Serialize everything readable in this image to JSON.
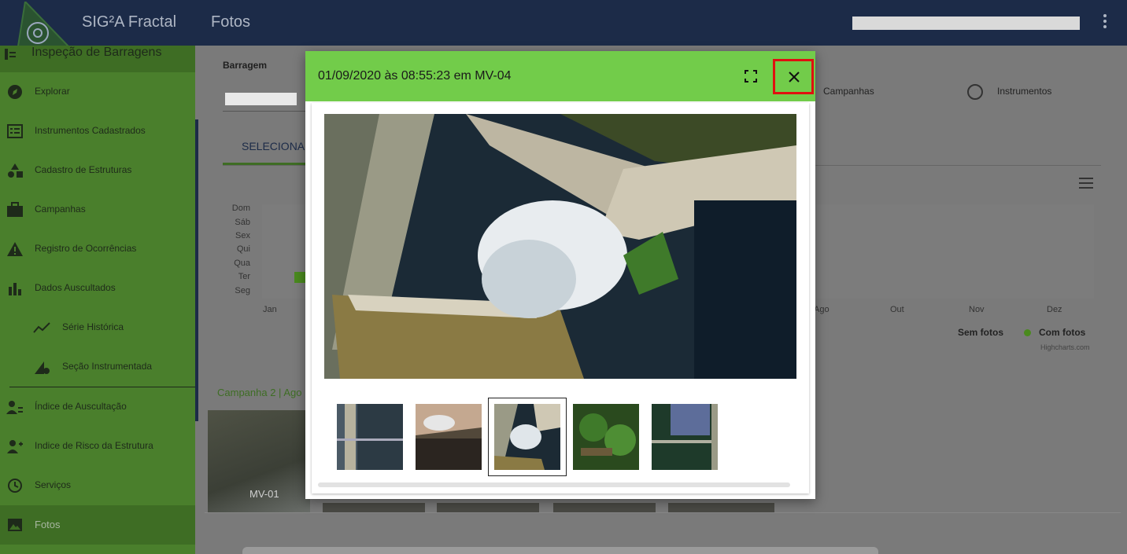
{
  "topbar": {
    "app_title": "SIG²A Fractal",
    "page_title": "Fotos"
  },
  "sidebar": {
    "header": "Inspeção de Barragens",
    "items": [
      {
        "label": "Explorar",
        "icon": "compass-icon"
      },
      {
        "label": "Instrumentos Cadastrados",
        "icon": "list-card-icon"
      },
      {
        "label": "Cadastro de Estruturas",
        "icon": "shapes-icon"
      },
      {
        "label": "Campanhas",
        "icon": "briefcase-icon"
      },
      {
        "label": "Registro de Ocorrências",
        "icon": "warning-icon"
      },
      {
        "label": "Dados Auscultados",
        "icon": "bar-chart-icon"
      },
      {
        "label": "Série Histórica",
        "icon": "trend-line-icon"
      },
      {
        "label": "Seção Instrumentada",
        "icon": "section-gear-icon"
      },
      {
        "label": "Índice de Auscultação",
        "icon": "person-list-icon"
      },
      {
        "label": "Indice de Risco da Estrutura",
        "icon": "person-add-icon"
      },
      {
        "label": "Serviços",
        "icon": "clock-icon"
      },
      {
        "label": "Fotos",
        "icon": "image-icon"
      }
    ]
  },
  "main": {
    "barragem_label": "Barragem",
    "tab_label": "SELECIONAR",
    "radio_campanhas": "Campanhas",
    "radio_instrumentos": "Instrumentos",
    "days": [
      "Dom",
      "Sáb",
      "Sex",
      "Qui",
      "Qua",
      "Ter",
      "Seg"
    ],
    "months": [
      "Jan",
      "Ago",
      "Out",
      "Nov",
      "Dez"
    ],
    "legend_sem": "Sem fotos",
    "legend_com": "Com fotos",
    "credits": "Highcharts.com",
    "campanha_label": "Campanha 2 | Ago",
    "thumb_label": "MV-01"
  },
  "modal": {
    "title": "01/09/2020 às 08:55:23 em MV-04",
    "selected_thumb_index": 2,
    "thumb_count": 5
  },
  "colors": {
    "topbar": "#1c2b48",
    "sidebar": "#4a7f2c",
    "modal_header": "#72cc4a",
    "close_highlight": "#e01010"
  }
}
